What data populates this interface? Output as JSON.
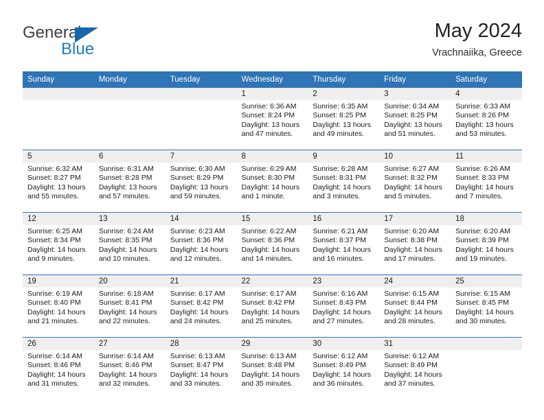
{
  "brand": {
    "name_part1": "General",
    "name_part2": "Blue",
    "accent_color": "#1668ab",
    "text_color": "#404040"
  },
  "header": {
    "title": "May 2024",
    "location": "Vrachnaiika, Greece",
    "header_bg_color": "#2f74b5",
    "daynum_band_color": "#efefef"
  },
  "weekdays": [
    "Sunday",
    "Monday",
    "Tuesday",
    "Wednesday",
    "Thursday",
    "Friday",
    "Saturday"
  ],
  "labels": {
    "sunrise_prefix": "Sunrise:",
    "sunset_prefix": "Sunset:",
    "daylight_prefix": "Daylight:"
  },
  "weeks": [
    [
      {
        "empty": true
      },
      {
        "empty": true
      },
      {
        "empty": true
      },
      {
        "day": "1",
        "sunrise": "Sunrise: 6:36 AM",
        "sunset": "Sunset: 8:24 PM",
        "daylight_l1": "Daylight: 13 hours",
        "daylight_l2": "and 47 minutes."
      },
      {
        "day": "2",
        "sunrise": "Sunrise: 6:35 AM",
        "sunset": "Sunset: 8:25 PM",
        "daylight_l1": "Daylight: 13 hours",
        "daylight_l2": "and 49 minutes."
      },
      {
        "day": "3",
        "sunrise": "Sunrise: 6:34 AM",
        "sunset": "Sunset: 8:25 PM",
        "daylight_l1": "Daylight: 13 hours",
        "daylight_l2": "and 51 minutes."
      },
      {
        "day": "4",
        "sunrise": "Sunrise: 6:33 AM",
        "sunset": "Sunset: 8:26 PM",
        "daylight_l1": "Daylight: 13 hours",
        "daylight_l2": "and 53 minutes."
      }
    ],
    [
      {
        "day": "5",
        "sunrise": "Sunrise: 6:32 AM",
        "sunset": "Sunset: 8:27 PM",
        "daylight_l1": "Daylight: 13 hours",
        "daylight_l2": "and 55 minutes."
      },
      {
        "day": "6",
        "sunrise": "Sunrise: 6:31 AM",
        "sunset": "Sunset: 8:28 PM",
        "daylight_l1": "Daylight: 13 hours",
        "daylight_l2": "and 57 minutes."
      },
      {
        "day": "7",
        "sunrise": "Sunrise: 6:30 AM",
        "sunset": "Sunset: 8:29 PM",
        "daylight_l1": "Daylight: 13 hours",
        "daylight_l2": "and 59 minutes."
      },
      {
        "day": "8",
        "sunrise": "Sunrise: 6:29 AM",
        "sunset": "Sunset: 8:30 PM",
        "daylight_l1": "Daylight: 14 hours",
        "daylight_l2": "and 1 minute."
      },
      {
        "day": "9",
        "sunrise": "Sunrise: 6:28 AM",
        "sunset": "Sunset: 8:31 PM",
        "daylight_l1": "Daylight: 14 hours",
        "daylight_l2": "and 3 minutes."
      },
      {
        "day": "10",
        "sunrise": "Sunrise: 6:27 AM",
        "sunset": "Sunset: 8:32 PM",
        "daylight_l1": "Daylight: 14 hours",
        "daylight_l2": "and 5 minutes."
      },
      {
        "day": "11",
        "sunrise": "Sunrise: 6:26 AM",
        "sunset": "Sunset: 8:33 PM",
        "daylight_l1": "Daylight: 14 hours",
        "daylight_l2": "and 7 minutes."
      }
    ],
    [
      {
        "day": "12",
        "sunrise": "Sunrise: 6:25 AM",
        "sunset": "Sunset: 8:34 PM",
        "daylight_l1": "Daylight: 14 hours",
        "daylight_l2": "and 9 minutes."
      },
      {
        "day": "13",
        "sunrise": "Sunrise: 6:24 AM",
        "sunset": "Sunset: 8:35 PM",
        "daylight_l1": "Daylight: 14 hours",
        "daylight_l2": "and 10 minutes."
      },
      {
        "day": "14",
        "sunrise": "Sunrise: 6:23 AM",
        "sunset": "Sunset: 8:36 PM",
        "daylight_l1": "Daylight: 14 hours",
        "daylight_l2": "and 12 minutes."
      },
      {
        "day": "15",
        "sunrise": "Sunrise: 6:22 AM",
        "sunset": "Sunset: 8:36 PM",
        "daylight_l1": "Daylight: 14 hours",
        "daylight_l2": "and 14 minutes."
      },
      {
        "day": "16",
        "sunrise": "Sunrise: 6:21 AM",
        "sunset": "Sunset: 8:37 PM",
        "daylight_l1": "Daylight: 14 hours",
        "daylight_l2": "and 16 minutes."
      },
      {
        "day": "17",
        "sunrise": "Sunrise: 6:20 AM",
        "sunset": "Sunset: 8:38 PM",
        "daylight_l1": "Daylight: 14 hours",
        "daylight_l2": "and 17 minutes."
      },
      {
        "day": "18",
        "sunrise": "Sunrise: 6:20 AM",
        "sunset": "Sunset: 8:39 PM",
        "daylight_l1": "Daylight: 14 hours",
        "daylight_l2": "and 19 minutes."
      }
    ],
    [
      {
        "day": "19",
        "sunrise": "Sunrise: 6:19 AM",
        "sunset": "Sunset: 8:40 PM",
        "daylight_l1": "Daylight: 14 hours",
        "daylight_l2": "and 21 minutes."
      },
      {
        "day": "20",
        "sunrise": "Sunrise: 6:18 AM",
        "sunset": "Sunset: 8:41 PM",
        "daylight_l1": "Daylight: 14 hours",
        "daylight_l2": "and 22 minutes."
      },
      {
        "day": "21",
        "sunrise": "Sunrise: 6:17 AM",
        "sunset": "Sunset: 8:42 PM",
        "daylight_l1": "Daylight: 14 hours",
        "daylight_l2": "and 24 minutes."
      },
      {
        "day": "22",
        "sunrise": "Sunrise: 6:17 AM",
        "sunset": "Sunset: 8:42 PM",
        "daylight_l1": "Daylight: 14 hours",
        "daylight_l2": "and 25 minutes."
      },
      {
        "day": "23",
        "sunrise": "Sunrise: 6:16 AM",
        "sunset": "Sunset: 8:43 PM",
        "daylight_l1": "Daylight: 14 hours",
        "daylight_l2": "and 27 minutes."
      },
      {
        "day": "24",
        "sunrise": "Sunrise: 6:15 AM",
        "sunset": "Sunset: 8:44 PM",
        "daylight_l1": "Daylight: 14 hours",
        "daylight_l2": "and 28 minutes."
      },
      {
        "day": "25",
        "sunrise": "Sunrise: 6:15 AM",
        "sunset": "Sunset: 8:45 PM",
        "daylight_l1": "Daylight: 14 hours",
        "daylight_l2": "and 30 minutes."
      }
    ],
    [
      {
        "day": "26",
        "sunrise": "Sunrise: 6:14 AM",
        "sunset": "Sunset: 8:46 PM",
        "daylight_l1": "Daylight: 14 hours",
        "daylight_l2": "and 31 minutes."
      },
      {
        "day": "27",
        "sunrise": "Sunrise: 6:14 AM",
        "sunset": "Sunset: 8:46 PM",
        "daylight_l1": "Daylight: 14 hours",
        "daylight_l2": "and 32 minutes."
      },
      {
        "day": "28",
        "sunrise": "Sunrise: 6:13 AM",
        "sunset": "Sunset: 8:47 PM",
        "daylight_l1": "Daylight: 14 hours",
        "daylight_l2": "and 33 minutes."
      },
      {
        "day": "29",
        "sunrise": "Sunrise: 6:13 AM",
        "sunset": "Sunset: 8:48 PM",
        "daylight_l1": "Daylight: 14 hours",
        "daylight_l2": "and 35 minutes."
      },
      {
        "day": "30",
        "sunrise": "Sunrise: 6:12 AM",
        "sunset": "Sunset: 8:49 PM",
        "daylight_l1": "Daylight: 14 hours",
        "daylight_l2": "and 36 minutes."
      },
      {
        "day": "31",
        "sunrise": "Sunrise: 6:12 AM",
        "sunset": "Sunset: 8:49 PM",
        "daylight_l1": "Daylight: 14 hours",
        "daylight_l2": "and 37 minutes."
      },
      {
        "empty": true
      }
    ]
  ]
}
